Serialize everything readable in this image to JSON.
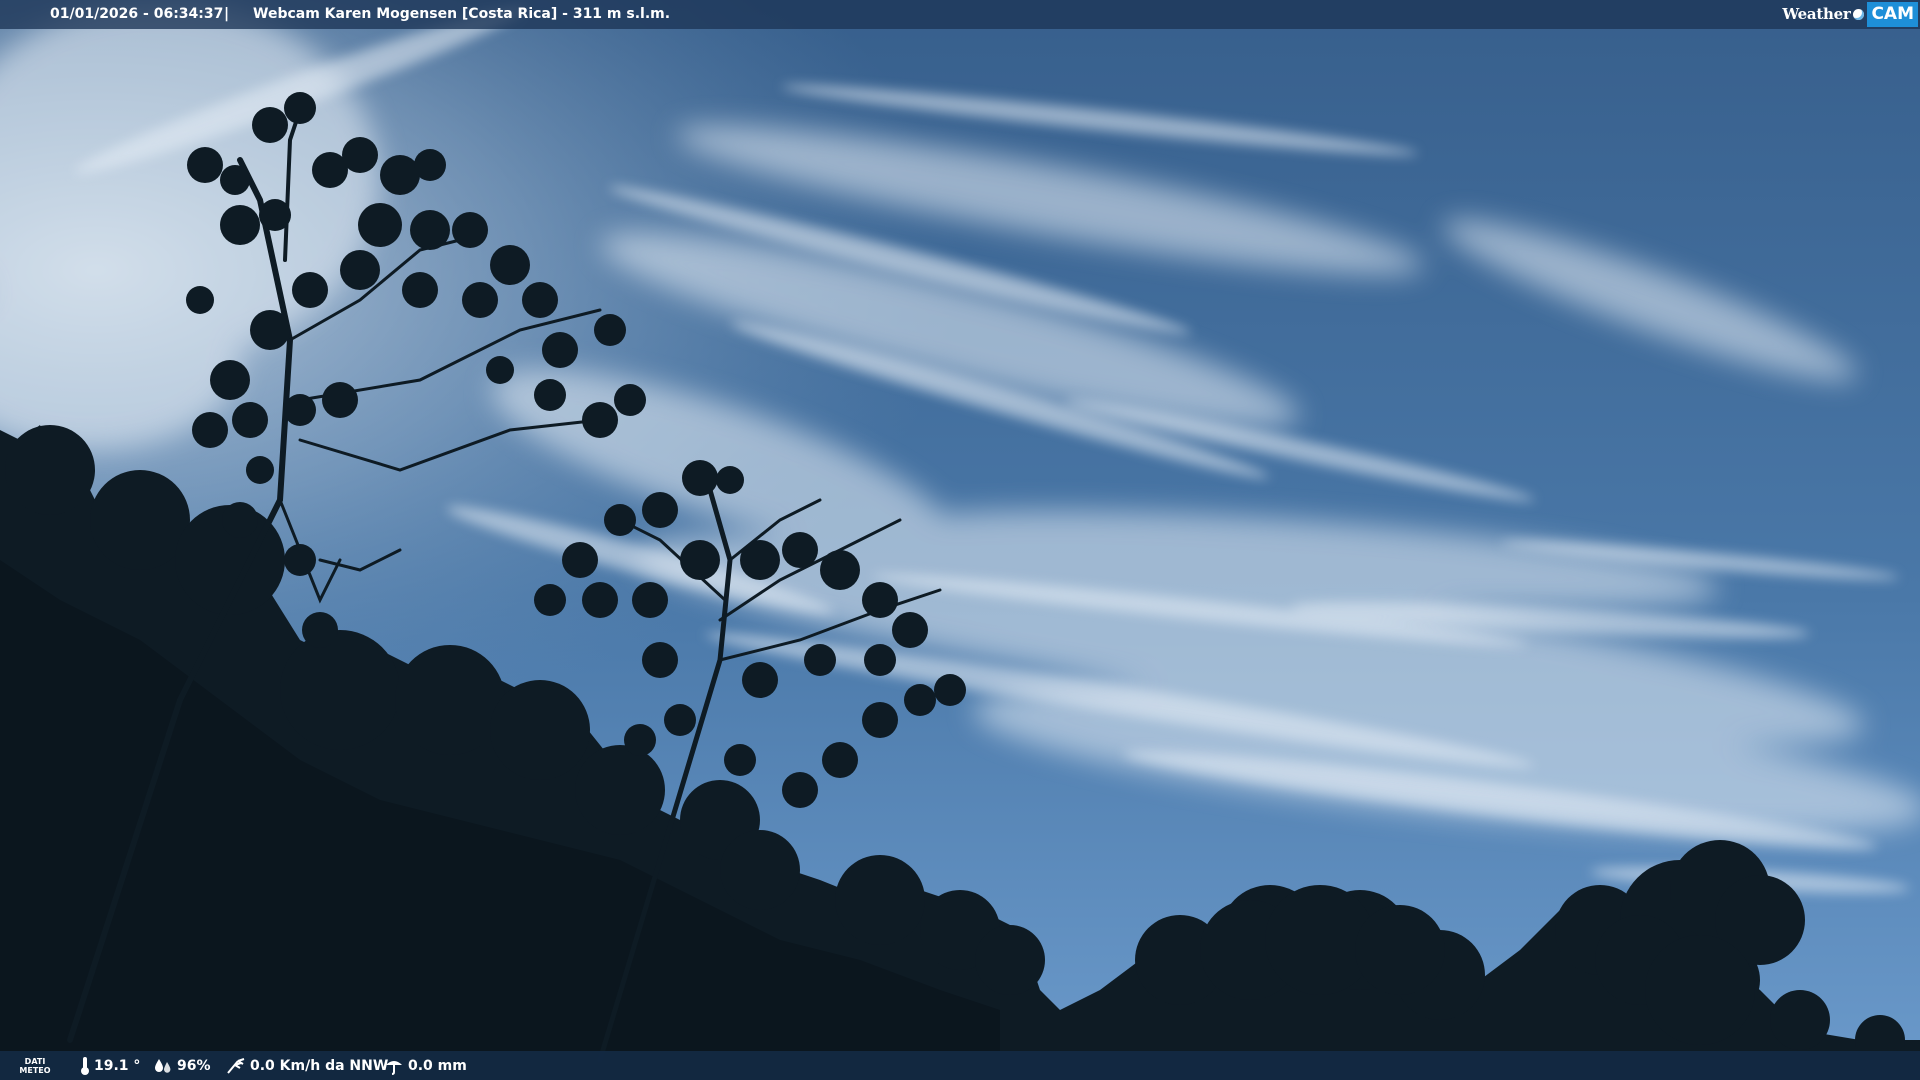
{
  "top_bar": {
    "timestamp": "01/01/2026 - 06:34:37",
    "separator": "|",
    "title": "Webcam Karen Mogensen [Costa Rica] - 311 m s.l.m.",
    "logo": {
      "word1": "Weather",
      "word2": "CAM",
      "accent_color": "#1e8fd8"
    }
  },
  "bottom_bar": {
    "label_line1": "DATI",
    "label_line2": "METEO",
    "temperature": "19.1 °",
    "humidity": "96%",
    "wind": "0.0 Km/h da NNW",
    "rain": "0.0 mm",
    "icons": [
      "thermometer-icon",
      "humidity-icon",
      "wind-icon",
      "rain-icon"
    ]
  },
  "scene_colors": {
    "sky_top": "#3a6593",
    "sky_bottom": "#5b8bbd",
    "cloud": "#e6eef6",
    "foliage": "#0d1a22"
  }
}
